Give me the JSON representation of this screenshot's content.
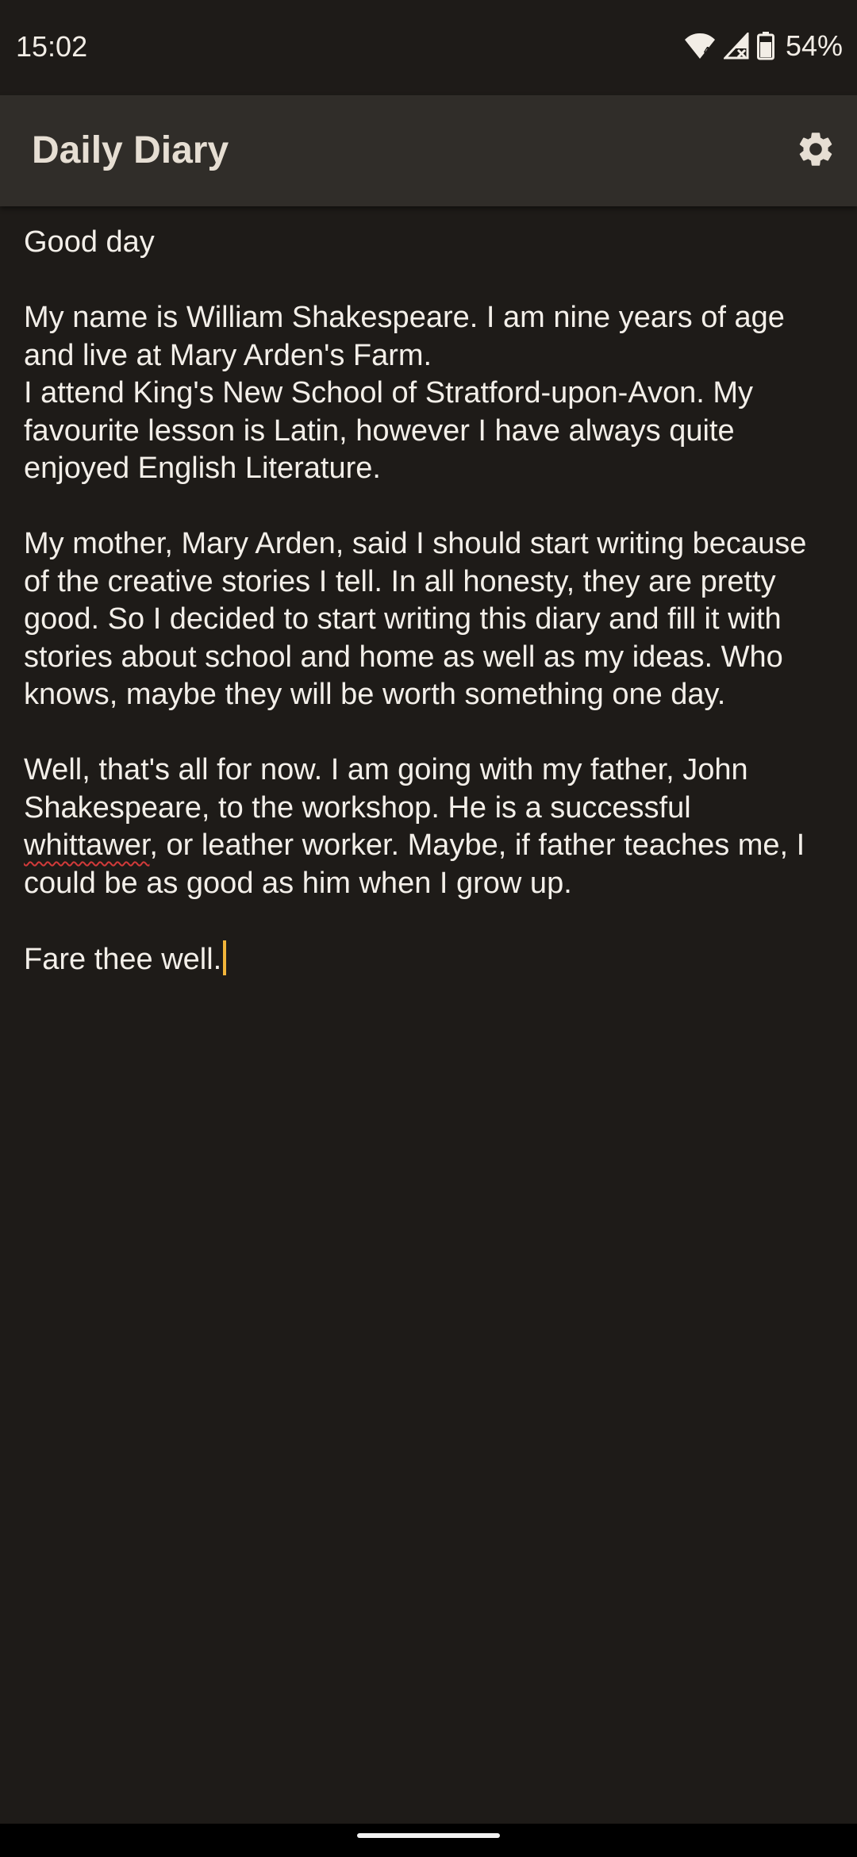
{
  "status_bar": {
    "time": "15:02",
    "wifi_badge": "4",
    "battery": "54%",
    "icons": [
      "wifi-icon",
      "signal-off-icon",
      "battery-icon"
    ]
  },
  "app_bar": {
    "title": "Daily Diary",
    "settings_icon": "gear-icon"
  },
  "entry": {
    "greeting": "Good day",
    "paragraph_1_a": "My name is William Shakespeare. I am nine years of age and live at Mary Arden's Farm.",
    "paragraph_1_b": "I attend King's New School of Stratford-upon-Avon. My favourite lesson is Latin, however I have always quite enjoyed English Literature.",
    "paragraph_2": "My mother, Mary Arden, said I should start writing because of the creative stories I tell. In all honesty, they are pretty good. So I decided to start writing this diary and fill it with stories about school and home as well as my ideas. Who knows, maybe they will be worth something one day.",
    "paragraph_3_start": "Well, that's all for now. I am going with my father, John Shakespeare, to the workshop. He is a successful ",
    "paragraph_3_misspelled": "whittawer",
    "paragraph_3_end": ", or leather worker. Maybe, if father teaches me, I could be as good as him when I grow up.",
    "signoff": "Fare thee well."
  },
  "colors": {
    "background": "#1e1b18",
    "app_bar": "#302d29",
    "text": "#f3efe9",
    "caret": "#f2b53a",
    "spellcheck": "#d23a3a"
  }
}
